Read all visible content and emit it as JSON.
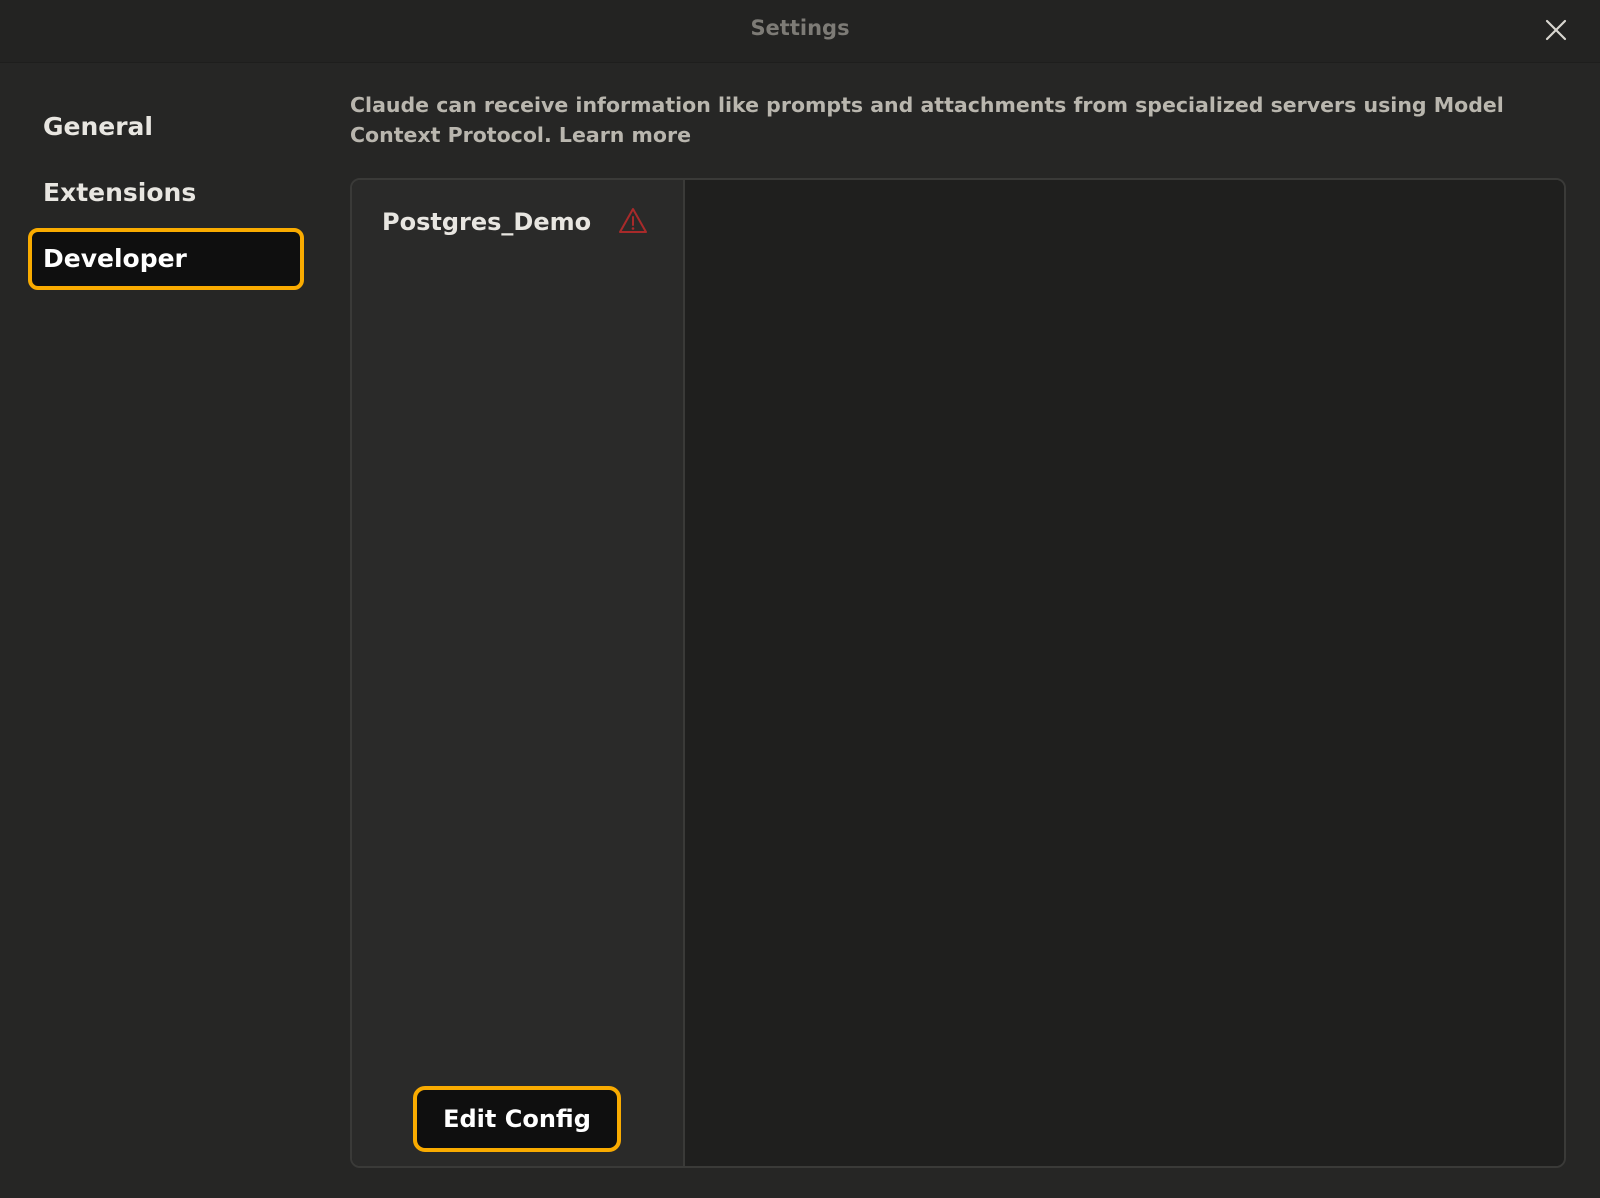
{
  "window": {
    "title": "Settings",
    "close_icon": "close-icon"
  },
  "sidebar": {
    "items": [
      {
        "label": "General",
        "active": false
      },
      {
        "label": "Extensions",
        "active": false
      },
      {
        "label": "Developer",
        "active": true
      }
    ]
  },
  "main": {
    "description_text": "Claude can receive information like prompts and attachments from specialized servers using Model Context Protocol.",
    "learn_more_label": "Learn more"
  },
  "servers": {
    "items": [
      {
        "name": "Postgres_Demo",
        "status_icon": "warning-icon"
      }
    ],
    "edit_config_label": "Edit Config"
  },
  "colors": {
    "highlight": "#f9ab00",
    "warning": "#c0392b"
  }
}
